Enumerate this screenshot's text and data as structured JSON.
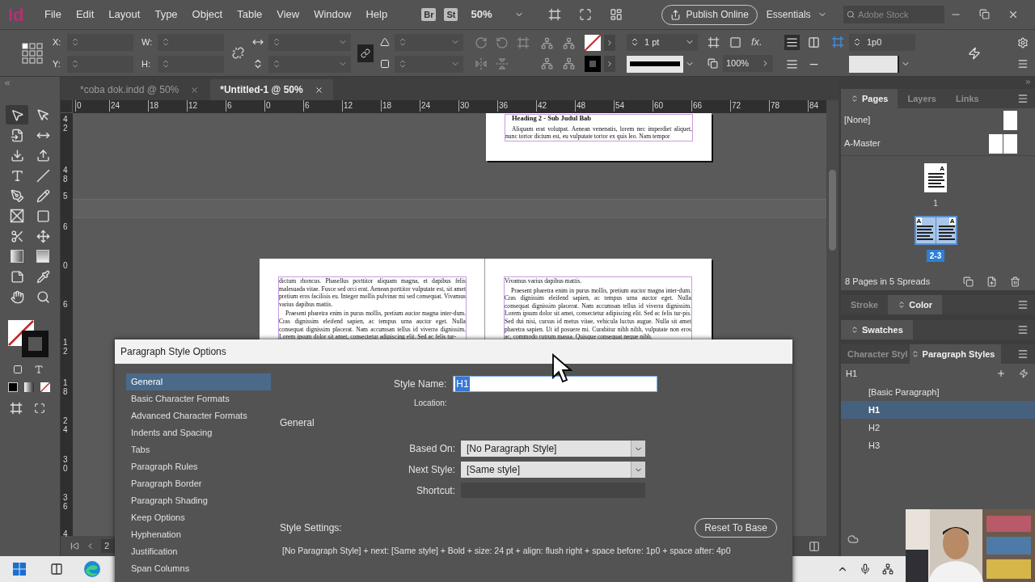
{
  "menu_bar": {
    "logo": "Id",
    "items": [
      "File",
      "Edit",
      "Layout",
      "Type",
      "Object",
      "Table",
      "View",
      "Window",
      "Help"
    ],
    "badges": [
      "Br",
      "St"
    ],
    "zoom": "50%",
    "publish_button": "Publish Online",
    "workspace": "Essentials",
    "search": {
      "placeholder": "Adobe Stock"
    }
  },
  "control_panel": {
    "position_labels": [
      "X:",
      "Y:"
    ],
    "size_labels": [
      "W:",
      "H:"
    ],
    "stroke_weight": "1 pt",
    "effects_label": "fx.",
    "opacity": "100%",
    "gutter": "1p0"
  },
  "tools": [
    {
      "selected": true
    },
    {
      "selected": false
    },
    {
      "selected": false
    },
    {
      "selected": false
    },
    {
      "selected": false
    },
    {
      "selected": false
    },
    {
      "selected": false
    },
    {
      "selected": false
    },
    {
      "selected": false
    },
    {
      "selected": false
    },
    {
      "selected": false
    },
    {
      "selected": false
    },
    {
      "selected": false
    },
    {
      "selected": false
    },
    {
      "selected": false
    },
    {
      "selected": false
    },
    {
      "selected": false
    },
    {
      "selected": false
    },
    {
      "selected": false
    },
    {
      "selected": false
    }
  ],
  "document_tabs": [
    {
      "label": "*coba dok.indd @ 50%",
      "selected": false
    },
    {
      "label": "*Untitled-1 @ 50%",
      "selected": true
    }
  ],
  "horizontal_ruler": [
    "0",
    "24",
    "18",
    "12",
    "6",
    "0",
    "6",
    "12",
    "18",
    "24",
    "30",
    "36",
    "42",
    "48",
    "54",
    "60",
    "66",
    "72",
    "78",
    "84"
  ],
  "vertical_ruler": [
    "42",
    "48",
    "5",
    "6",
    "0",
    "6",
    "12",
    "18",
    "24",
    "30",
    "36",
    "4"
  ],
  "pages": [
    {
      "kind": "single",
      "paragraphs": [
        {
          "kind": "heading",
          "text": "Heading 2 - Sub Judul Bab"
        },
        {
          "kind": "indented",
          "text": "Aliquam erat volutpat. Aenean venenatis, lorem nec imperdiet aliquet, nunc tortor dictum est, eu vulputate tortor ex quis leo. Nam tempor"
        }
      ]
    },
    {
      "kind": "left",
      "paragraphs": [
        {
          "kind": "continued",
          "text": "dictum rhoncus. Phasellus porttitor aliquam magna, et dapibus felis malesuada vitae. Fusce sed orci erat. Aenean porttitor vulputate est, sit amet pretium eros facilisis eu. Integer mollis pulvinar mi sed consequat. Vivamus varius dapibus mattis."
        },
        {
          "kind": "indented",
          "text": "Praesent pharetra enim in purus mollis, pretium auctor magna inter-dum. Cras dignissim eleifend sapien, ac tempus urna auctor eget. Nulla consequat dignissim placerat. Nam accumsan tellus id viverra dignissim. Lorem ipsum dolor sit amet, consectetur adipiscing elit. Sed ac felis tur-"
        }
      ]
    },
    {
      "kind": "right",
      "paragraphs": [
        {
          "kind": "continued",
          "text": "Vivamus varius dapibus mattis."
        },
        {
          "kind": "indented",
          "text": "Praesent pharetra enim in purus mollis, pretium auctor magna inter-dum. Cras dignissim eleifend sapien, ac tempus urna auctor eget. Nulla consequat dignissim placerat. Nam accumsan tellus id viverra dignissim. Lorem ipsum dolor sit amet, consectetur adipiscing elit. Sed ac felis tur-pis. Sed dui nisi, cursus id metus vitae, vehicula luctus augue. Nulla sit amet pharetra sapien. Ut id posuere mi. Curabitur nibh nibh, vulputate non eros ac, commodo rutrum massa. Quisque consequat neque nibh."
        }
      ]
    }
  ],
  "status_bar": {
    "page_number": "2"
  },
  "right_panel": {
    "pages_tabs": [
      {
        "label": "Pages",
        "selected": true
      },
      {
        "label": "Layers",
        "selected": false
      },
      {
        "label": "Links",
        "selected": false
      }
    ],
    "masters": [
      {
        "name": "[None]",
        "kind": "single"
      },
      {
        "name": "A-Master",
        "kind": "spread"
      }
    ],
    "spreads": [
      {
        "label": "1",
        "masters": [
          "A"
        ],
        "selected": false
      },
      {
        "label": "2-3",
        "masters": [
          "A",
          "A"
        ],
        "selected": true
      }
    ],
    "pages_summary": "8 Pages in 5 Spreads",
    "color_tabs": [
      {
        "label": "Stroke",
        "selected": false
      },
      {
        "label": "Color",
        "selected": true
      }
    ],
    "swatches_tabs": [
      {
        "label": "Swatches",
        "selected": true
      }
    ],
    "style_tabs": [
      {
        "label": "Character Styl",
        "selected": false
      },
      {
        "label": "Paragraph Styles",
        "selected": true
      }
    ],
    "current_style": "H1",
    "paragraph_styles": [
      {
        "name": "[Basic Paragraph]",
        "selected": false
      },
      {
        "name": "H1",
        "selected": true
      },
      {
        "name": "H2",
        "selected": false
      },
      {
        "name": "H3",
        "selected": false
      }
    ]
  },
  "dialog": {
    "title": "Paragraph Style Options",
    "sections": [
      {
        "label": "General",
        "selected": true
      },
      {
        "label": "Basic Character Formats",
        "selected": false
      },
      {
        "label": "Advanced Character Formats",
        "selected": false
      },
      {
        "label": "Indents and Spacing",
        "selected": false
      },
      {
        "label": "Tabs",
        "selected": false
      },
      {
        "label": "Paragraph Rules",
        "selected": false
      },
      {
        "label": "Paragraph Border",
        "selected": false
      },
      {
        "label": "Paragraph Shading",
        "selected": false
      },
      {
        "label": "Keep Options",
        "selected": false
      },
      {
        "label": "Hyphenation",
        "selected": false
      },
      {
        "label": "Justification",
        "selected": false
      },
      {
        "label": "Span Columns",
        "selected": false
      }
    ],
    "style_name_label": "Style Name:",
    "style_name": "H1",
    "location_label": "Location:",
    "heading": "General",
    "based_on_label": "Based On:",
    "based_on": "[No Paragraph Style]",
    "next_style_label": "Next Style:",
    "next_style": "[Same style]",
    "shortcut_label": "Shortcut:",
    "settings_label": "Style Settings:",
    "reset_button": "Reset To Base",
    "settings_summary": "[No Paragraph Style] + next: [Same style] + Bold + size: 24 pt + align: flush right + space before: 1p0 + space after: 4p0"
  }
}
